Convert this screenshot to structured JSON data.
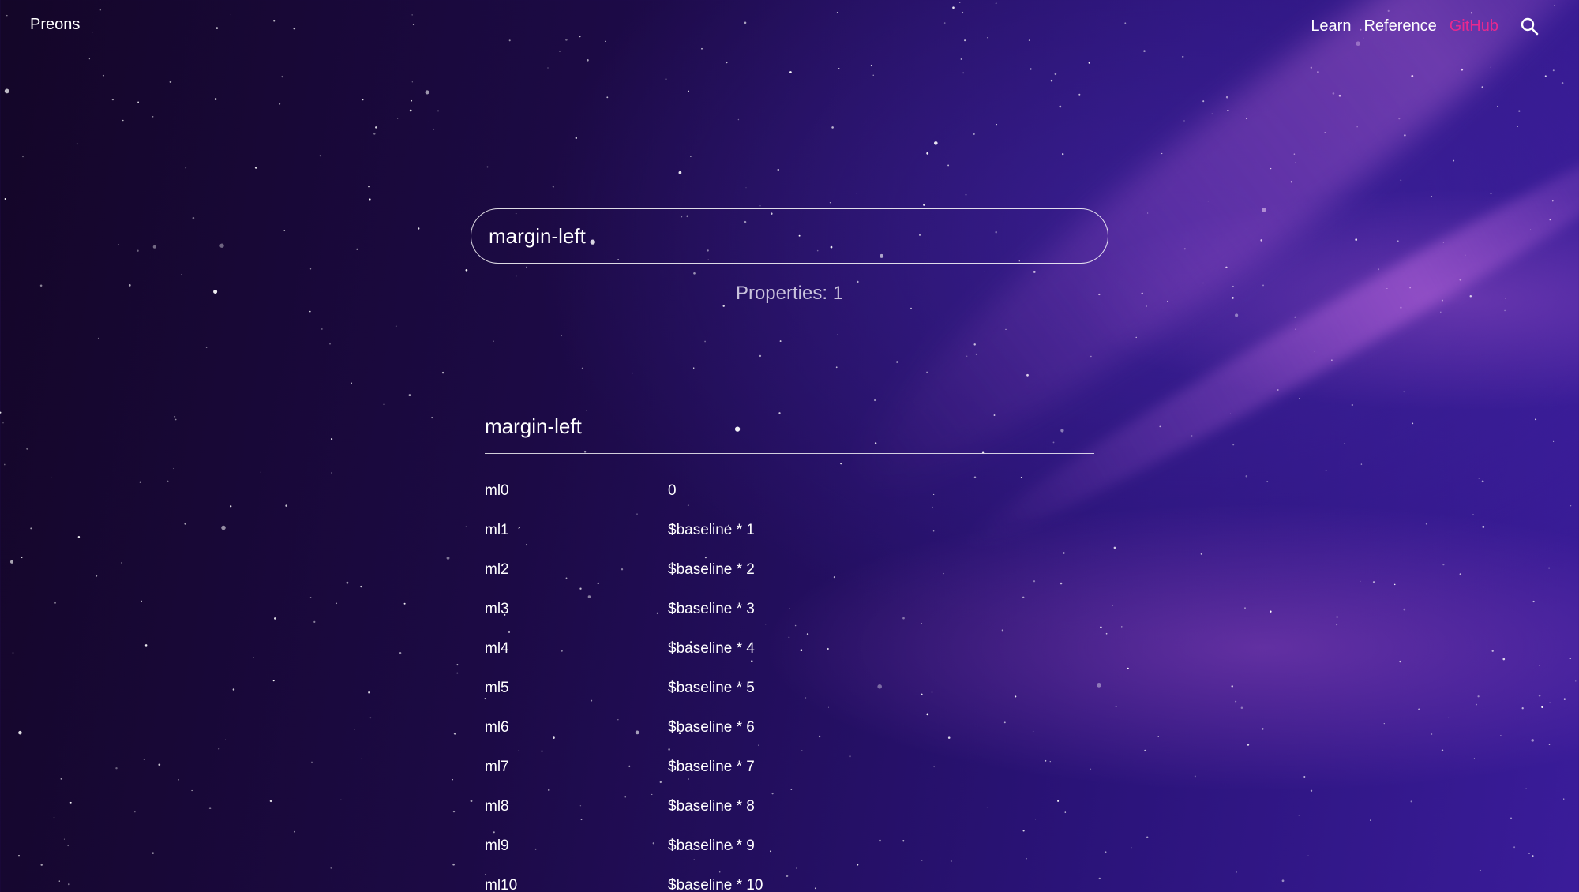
{
  "header": {
    "brand": "Preons",
    "nav": [
      {
        "label": "Learn"
      },
      {
        "label": "Reference"
      },
      {
        "label": "GitHub"
      }
    ],
    "search_icon": "search-icon",
    "accent_color": "#e8288f"
  },
  "search": {
    "value": "margin-left",
    "placeholder": ""
  },
  "results": {
    "label": "Properties:",
    "count": "1"
  },
  "property": {
    "title": "margin-left",
    "rows": [
      {
        "cls": "ml0",
        "val": "0"
      },
      {
        "cls": "ml1",
        "val": "$baseline * 1"
      },
      {
        "cls": "ml2",
        "val": "$baseline * 2"
      },
      {
        "cls": "ml3",
        "val": "$baseline * 3"
      },
      {
        "cls": "ml4",
        "val": "$baseline * 4"
      },
      {
        "cls": "ml5",
        "val": "$baseline * 5"
      },
      {
        "cls": "ml6",
        "val": "$baseline * 6"
      },
      {
        "cls": "ml7",
        "val": "$baseline * 7"
      },
      {
        "cls": "ml8",
        "val": "$baseline * 8"
      },
      {
        "cls": "ml9",
        "val": "$baseline * 9"
      },
      {
        "cls": "ml10",
        "val": "$baseline * 10"
      }
    ]
  }
}
